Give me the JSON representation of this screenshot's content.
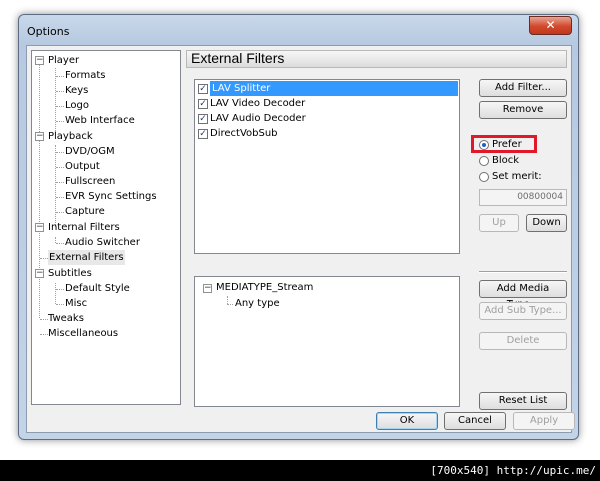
{
  "window": {
    "title": "Options",
    "close_glyph": "✕"
  },
  "tree": {
    "items": [
      {
        "label": "Player",
        "toggle": "−"
      },
      {
        "label": "Formats"
      },
      {
        "label": "Keys"
      },
      {
        "label": "Logo"
      },
      {
        "label": "Web Interface"
      },
      {
        "label": "Playback",
        "toggle": "−"
      },
      {
        "label": "DVD/OGM"
      },
      {
        "label": "Output"
      },
      {
        "label": "Fullscreen"
      },
      {
        "label": "EVR Sync Settings"
      },
      {
        "label": "Capture"
      },
      {
        "label": "Internal Filters",
        "toggle": "−"
      },
      {
        "label": "Audio Switcher"
      },
      {
        "label": "External Filters",
        "selected": true
      },
      {
        "label": "Subtitles",
        "toggle": "−"
      },
      {
        "label": "Default Style"
      },
      {
        "label": "Misc"
      },
      {
        "label": "Tweaks"
      },
      {
        "label": "Miscellaneous"
      }
    ]
  },
  "page": {
    "title": "External Filters",
    "filters": [
      {
        "label": "LAV Splitter",
        "checked": true,
        "selected": true
      },
      {
        "label": "LAV Video Decoder",
        "checked": true
      },
      {
        "label": "LAV Audio Decoder",
        "checked": true
      },
      {
        "label": "DirectVobSub",
        "checked": true
      }
    ],
    "check_glyph": "✓",
    "buttons": {
      "add_filter": "Add Filter...",
      "remove": "Remove",
      "up": "Up",
      "down": "Down",
      "add_media_type": "Add Media Type...",
      "add_sub_type": "Add Sub Type...",
      "delete": "Delete",
      "reset_list": "Reset List"
    },
    "merit_options": {
      "prefer": "Prefer",
      "block": "Block",
      "set_merit": "Set merit:"
    },
    "merit_value": "00800004",
    "media_tree": {
      "toggle": "−",
      "root": "MEDIATYPE_Stream",
      "child": "Any type"
    }
  },
  "footer": {
    "ok": "OK",
    "cancel": "Cancel",
    "apply": "Apply"
  },
  "watermark": "[700x540] http://upic.me/",
  "colors": {
    "selection": "#3399ff",
    "highlight_box": "#e0182a",
    "close_button": "#d2482c"
  }
}
